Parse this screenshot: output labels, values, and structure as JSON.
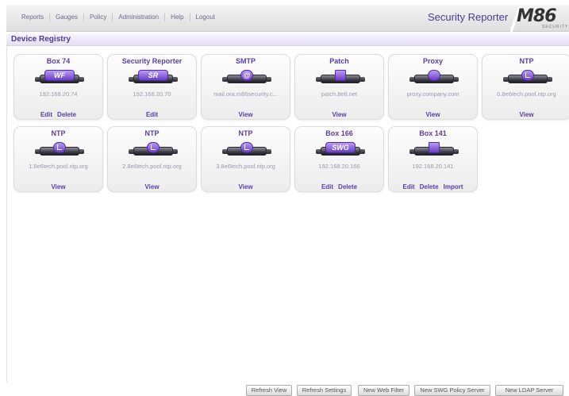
{
  "header": {
    "menu": [
      "Reports",
      "Gauges",
      "Policy",
      "Administration",
      "Help",
      "Logout"
    ],
    "app_title": "Security Reporter",
    "logo_text": "M86",
    "logo_subtext": "SECURITY"
  },
  "section_title": "Device Registry",
  "devices": [
    {
      "title": "Box 74",
      "badge": "WF",
      "address": "192.168.20.74",
      "actions": [
        "Edit",
        "Delete"
      ]
    },
    {
      "title": "Security Reporter",
      "badge": "SR",
      "address": "192.168.20.70",
      "actions": [
        "Edit"
      ]
    },
    {
      "title": "SMTP",
      "badge": "@",
      "address": "mail.ora.m86security.c...",
      "actions": [
        "View"
      ]
    },
    {
      "title": "Patch",
      "badge": "",
      "address": "patch.8e6.net",
      "actions": [
        "View"
      ]
    },
    {
      "title": "Proxy",
      "badge": "",
      "address": "proxy.company.com",
      "actions": [
        "View"
      ]
    },
    {
      "title": "NTP",
      "badge": "",
      "address": "0.8e6tech.pool.ntp.org",
      "actions": [
        "View"
      ]
    },
    {
      "title": "NTP",
      "badge": "",
      "address": "1.8e6tech.pool.ntp.org",
      "actions": [
        "View"
      ]
    },
    {
      "title": "NTP",
      "badge": "",
      "address": "2.8e6tech.pool.ntp.org",
      "actions": [
        "View"
      ]
    },
    {
      "title": "NTP",
      "badge": "",
      "address": "3.8e6tech.pool.ntp.org",
      "actions": [
        "View"
      ]
    },
    {
      "title": "Box 166",
      "badge": "SWG",
      "address": "192.168.20.166",
      "actions": [
        "Edit",
        "Delete"
      ]
    },
    {
      "title": "Box 141",
      "badge": "",
      "address": "192.168.20.141",
      "actions": [
        "Edit",
        "Delete",
        "Import"
      ]
    }
  ],
  "buttons": [
    "Refresh View",
    "Refresh Settings",
    "New Web Filter",
    "New SWG Policy Server",
    "New LDAP Server"
  ]
}
